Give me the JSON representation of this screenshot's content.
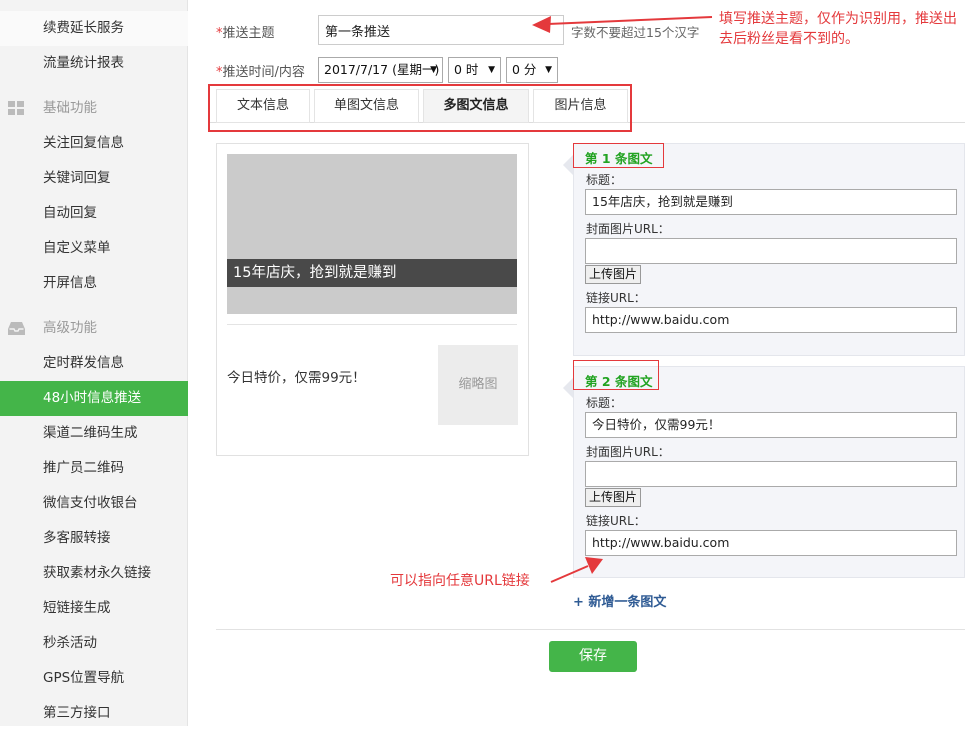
{
  "sidebar": {
    "top_items": [
      {
        "label": "续费延长服务"
      },
      {
        "label": "流量统计报表"
      }
    ],
    "section_basic": "基础功能",
    "basic_items": [
      {
        "label": "关注回复信息"
      },
      {
        "label": "关键词回复"
      },
      {
        "label": "自动回复"
      },
      {
        "label": "自定义菜单"
      },
      {
        "label": "开屏信息"
      }
    ],
    "section_advanced": "高级功能",
    "advanced_items": [
      {
        "label": "定时群发信息"
      },
      {
        "label": "48小时信息推送"
      },
      {
        "label": "渠道二维码生成"
      },
      {
        "label": "推广员二维码"
      },
      {
        "label": "微信支付收银台"
      },
      {
        "label": "多客服转接"
      },
      {
        "label": "获取素材永久链接"
      },
      {
        "label": "短链接生成"
      },
      {
        "label": "秒杀活动"
      },
      {
        "label": "GPS位置导航"
      },
      {
        "label": "第三方接口"
      }
    ],
    "active_label": "48小时信息推送",
    "active_color": "#44b549"
  },
  "form": {
    "topic_label_star": "*",
    "topic_label": "推送主题",
    "topic_value": "第一条推送",
    "topic_hint": "字数不要超过15个汉字",
    "time_label_star": "*",
    "time_label": "推送时间/内容",
    "date_value": "2017/7/17 (星期一)",
    "hour_value": "0 时",
    "minute_value": "0 分"
  },
  "tabs": [
    {
      "label": "文本信息"
    },
    {
      "label": "单图文信息"
    },
    {
      "label": "多图文信息"
    },
    {
      "label": "图片信息"
    }
  ],
  "preview": {
    "cover_title": "15年店庆，抢到就是赚到",
    "item2_text": "今日特价，仅需99元！",
    "thumb_label": "缩略图"
  },
  "panel1": {
    "title_pre": "第",
    "title_num": "1",
    "title_post": "条图文",
    "title_label": "标题：",
    "title_value": "15年店庆，抢到就是赚到",
    "cover_label": "封面图片URL：",
    "cover_value": "",
    "upload_label": "上传图片",
    "link_label": "链接URL：",
    "link_value": "http://www.baidu.com"
  },
  "panel2": {
    "title_pre": "第",
    "title_num": "2",
    "title_post": "条图文",
    "title_label": "标题：",
    "title_value": "今日特价，仅需99元！",
    "cover_label": "封面图片URL：",
    "cover_value": "",
    "upload_label": "上传图片",
    "link_label": "链接URL：",
    "link_value": "http://www.baidu.com"
  },
  "add_item_label": "+ 新增一条图文",
  "save_label": "保存",
  "annotations": {
    "top": "填写推送主题，仅作为识别用，推送出去后粉丝是看不到的。",
    "bottom": "可以指向任意URL链接",
    "color": "#e4393c"
  }
}
